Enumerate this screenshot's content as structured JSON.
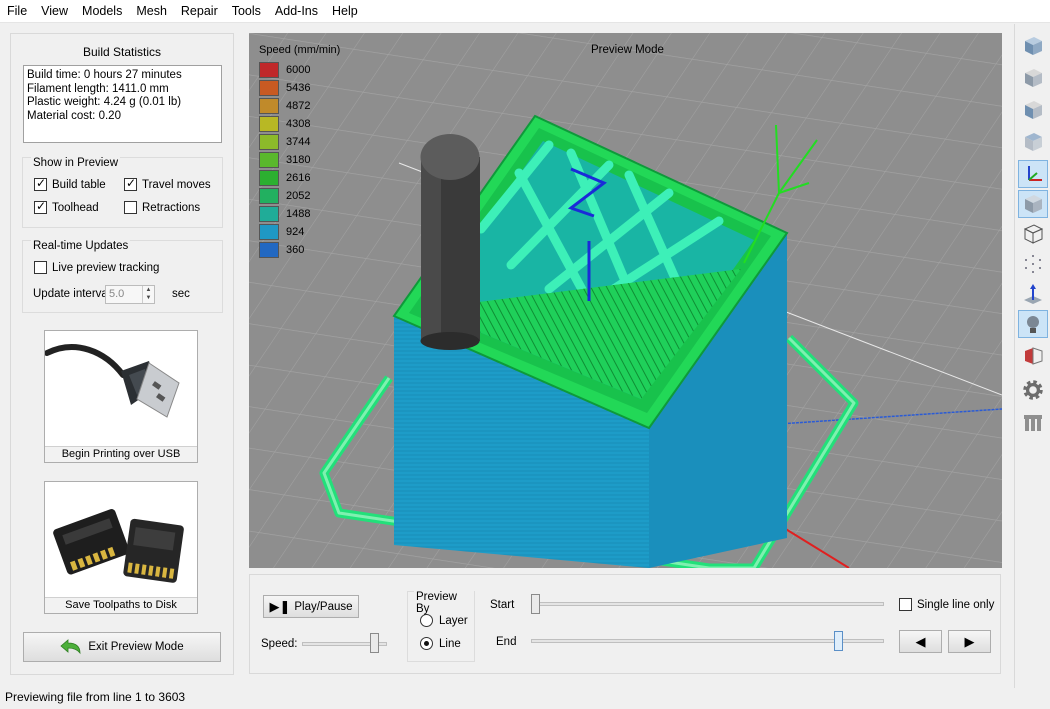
{
  "menu": [
    "File",
    "View",
    "Models",
    "Mesh",
    "Repair",
    "Tools",
    "Add-Ins",
    "Help"
  ],
  "build_stats": {
    "title": "Build Statistics",
    "lines": [
      "Build time: 0 hours 27 minutes",
      "Filament length: 1411.0 mm",
      "Plastic weight: 4.24 g (0.01 lb)",
      "Material cost: 0.20"
    ]
  },
  "show_in_preview": {
    "title": "Show in Preview",
    "build_table": {
      "label": "Build table",
      "checked": true
    },
    "travel_moves": {
      "label": "Travel moves",
      "checked": true
    },
    "toolhead": {
      "label": "Toolhead",
      "checked": true
    },
    "retractions": {
      "label": "Retractions",
      "checked": false
    }
  },
  "realtime": {
    "title": "Real-time Updates",
    "live_label": "Live preview tracking",
    "live_checked": false,
    "interval_label": "Update interval",
    "interval_value": "5.0",
    "interval_unit": "sec"
  },
  "usb_button": {
    "label": "Begin Printing over USB"
  },
  "save_button": {
    "label": "Save Toolpaths to Disk"
  },
  "exit_button": {
    "label": "Exit Preview Mode"
  },
  "viewport": {
    "mode_label": "Preview Mode",
    "legend_title": "Speed (mm/min)",
    "legend": [
      {
        "value": "6000",
        "color": "#c0282a"
      },
      {
        "value": "5436",
        "color": "#c85a22"
      },
      {
        "value": "4872",
        "color": "#c08a2a"
      },
      {
        "value": "4308",
        "color": "#b8b824"
      },
      {
        "value": "3744",
        "color": "#8cba2a"
      },
      {
        "value": "3180",
        "color": "#5ab82c"
      },
      {
        "value": "2616",
        "color": "#2cb030"
      },
      {
        "value": "2052",
        "color": "#22b060"
      },
      {
        "value": "1488",
        "color": "#20ac98"
      },
      {
        "value": "924",
        "color": "#1f98c4"
      },
      {
        "value": "360",
        "color": "#2268c2"
      }
    ]
  },
  "controls": {
    "play_pause": "Play/Pause",
    "speed_label": "Speed:",
    "speed_level": 0.9,
    "preview_by_title": "Preview By",
    "preview_by_options": [
      "Layer",
      "Line"
    ],
    "preview_by_selected": "Line",
    "start_label": "Start",
    "end_label": "End",
    "start_level": 0.0,
    "end_level": 0.88,
    "single_line_label": "Single line only",
    "single_line_checked": false
  },
  "toolbar_icons": [
    "iso-view-icon",
    "front-view-icon",
    "side-view-icon",
    "top-view-icon",
    "axes-icon",
    "solid-view-icon",
    "wireframe-icon",
    "point-cloud-icon",
    "normals-icon",
    "light-icon",
    "section-view-icon",
    "settings-gear-icon",
    "support-icon"
  ],
  "status": "Previewing file from line 1 to 3603",
  "colors": {
    "accent": "#cce4f7",
    "model_blue": "#1f98c4",
    "model_green": "#22d15a"
  }
}
